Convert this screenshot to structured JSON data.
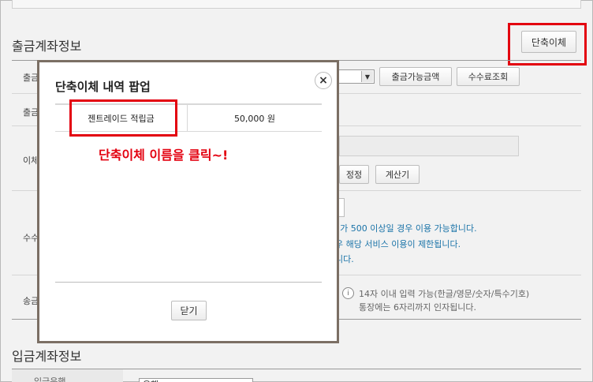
{
  "sections": {
    "withdraw_title": "출금계좌정보",
    "deposit_title": "입금계좌정보"
  },
  "buttons": {
    "shortcut_transfer": "단축이체",
    "available_amount": "출금가능금액",
    "fee_lookup": "수수료조회",
    "correct": "정정",
    "calculator": "계산기"
  },
  "row_labels": {
    "row1": "출금",
    "row2": "출금",
    "row3": "이체",
    "row4": "수수",
    "row5": "송금",
    "row6": "입금은행"
  },
  "notes": {
    "line1": "리가 500 이상일 경우 이용 가능합니다.",
    "line2": "우 해당 서비스 이용이 제한됩니다.",
    "line3": "니다.",
    "memo1": "14자 이내 입력 가능(한글/영문/숫자/특수기호)",
    "memo2": "통장에는 6자리까지 인자됩니다."
  },
  "deposit": {
    "bank_value": "은행"
  },
  "popup": {
    "title": "단축이체 내역 팝업",
    "close_symbol": "×",
    "rows": [
      {
        "name": "젠트레이드 적립금",
        "amount": "50,000 원"
      }
    ],
    "close_button": "닫기"
  },
  "annotation": "단축이체 이름을 클릭~!",
  "colors": {
    "highlight_red": "#e3000f",
    "info_blue": "#1a73a8",
    "popup_border": "#7b6f64"
  },
  "icons": {
    "info": "info-circle-icon",
    "dropdown": "chevron-down-icon",
    "close": "close-icon"
  }
}
